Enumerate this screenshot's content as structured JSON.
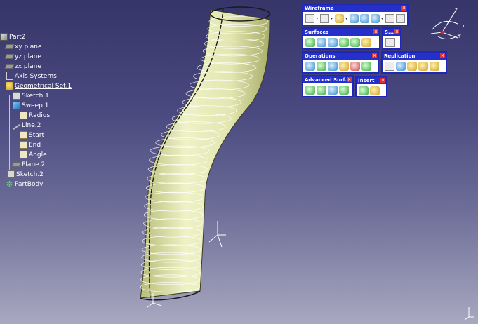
{
  "tree": {
    "root": "Part2",
    "xy_plane": "xy plane",
    "yz_plane": "yz plane",
    "zx_plane": "zx plane",
    "axis_systems": "Axis Systems",
    "geometrical_set": "Geometrical Set.1",
    "sketch1": "Sketch.1",
    "sweep1": "Sweep.1",
    "radius": "Radius",
    "line2": "Line.2",
    "start": "Start",
    "end": "End",
    "angle": "Angle",
    "plane2": "Plane.2",
    "sketch2": "Sketch.2",
    "partbody": "PartBody"
  },
  "toolbars": {
    "wireframe": "Wireframe",
    "surfaces": "Surfaces",
    "s_short": "S...",
    "operations": "Operations",
    "replication": "Replication",
    "advanced_surf": "Advanced Surf...",
    "insert": "Insert",
    "close_glyph": "×"
  },
  "compass": {
    "x": "x",
    "y": "y",
    "z": "z"
  },
  "colors": {
    "background_top": "#35356a",
    "background_bottom": "#a8a8c0",
    "surface_fill": "#f0f3c8",
    "toolbar_title": "#2430c9"
  },
  "icons": [
    "part-icon",
    "plane-icon",
    "axis-system-icon",
    "geometrical-set-icon",
    "sketch-icon",
    "sweep-icon",
    "parameter-icon",
    "line-icon",
    "body-icon",
    "compass-icon"
  ]
}
